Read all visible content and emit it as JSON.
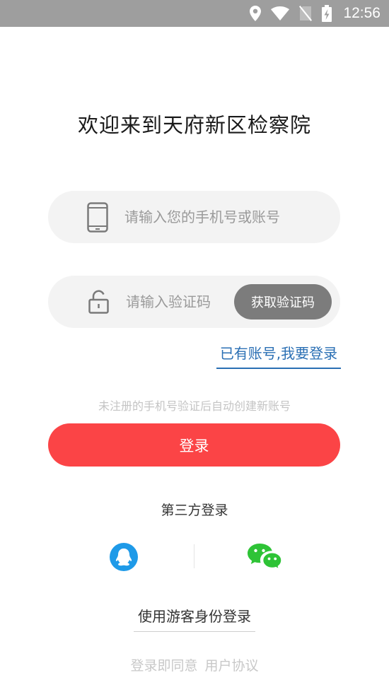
{
  "status_bar": {
    "time": "12:56",
    "icons": [
      "location-icon",
      "wifi-icon",
      "no-sim-icon",
      "battery-charging-icon"
    ]
  },
  "title": "欢迎来到天府新区检察院",
  "phone_field": {
    "placeholder": "请输入您的手机号或账号",
    "value": "",
    "icon": "phone-icon"
  },
  "code_field": {
    "placeholder": "请输入验证码",
    "value": "",
    "icon": "lock-icon",
    "button_label": "获取验证码"
  },
  "account_login_link": "已有账号,我要登录",
  "hint": "未注册的手机号验证后自动创建新账号",
  "login_button": "登录",
  "third_party": {
    "title": "第三方登录",
    "providers": [
      "qq-icon",
      "wechat-icon"
    ]
  },
  "guest_link": "使用游客身份登录",
  "agreement": {
    "prefix": "登录即同意",
    "link": "用户协议"
  },
  "colors": {
    "accent_red": "#fb4446",
    "link_blue": "#2a6fb4",
    "qq_blue": "#1e9ae8",
    "wechat_green": "#2ec336",
    "status_bar": "#9e9e9e"
  }
}
